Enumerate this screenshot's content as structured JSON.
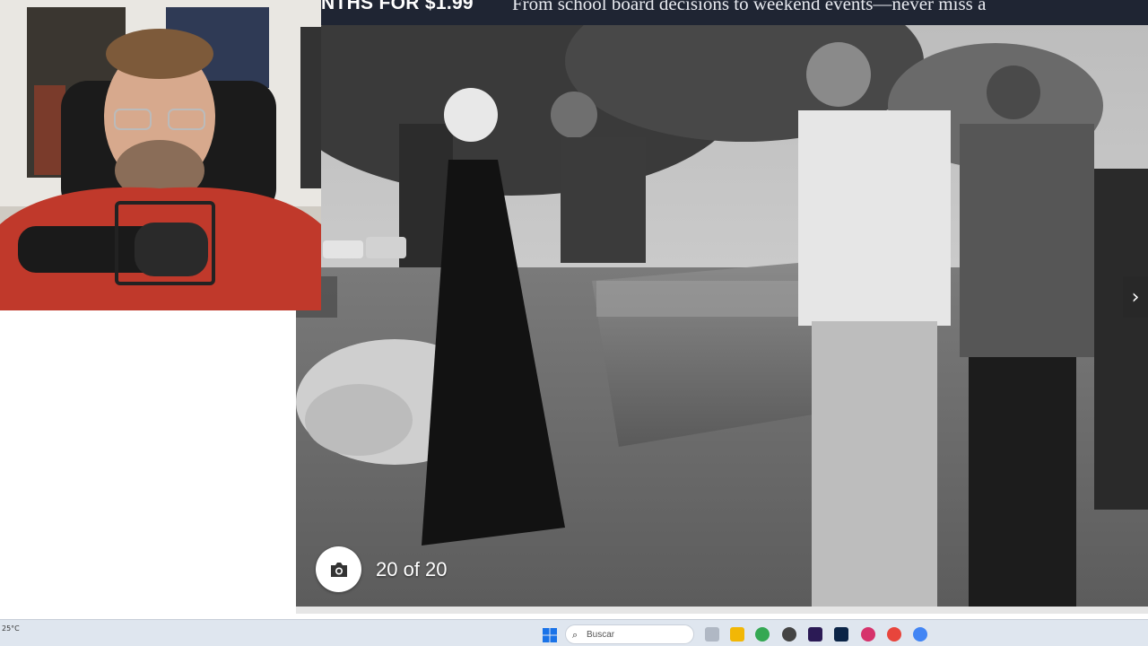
{
  "banner": {
    "deal_text": "NTHS FOR $1.99",
    "tagline": "From school board decisions to weekend events—never miss a"
  },
  "gallery": {
    "counter_text": "20 of 20",
    "next_glyph": "›",
    "prev_glyph": ""
  },
  "taskbar": {
    "weather_text": "25°C",
    "search_placeholder": "Buscar",
    "search_glyph": "⌕"
  },
  "colors": {
    "banner_bg": "#1f2533",
    "taskbar_bg": "#dfe6ef",
    "shirt_red": "#c0392b"
  }
}
